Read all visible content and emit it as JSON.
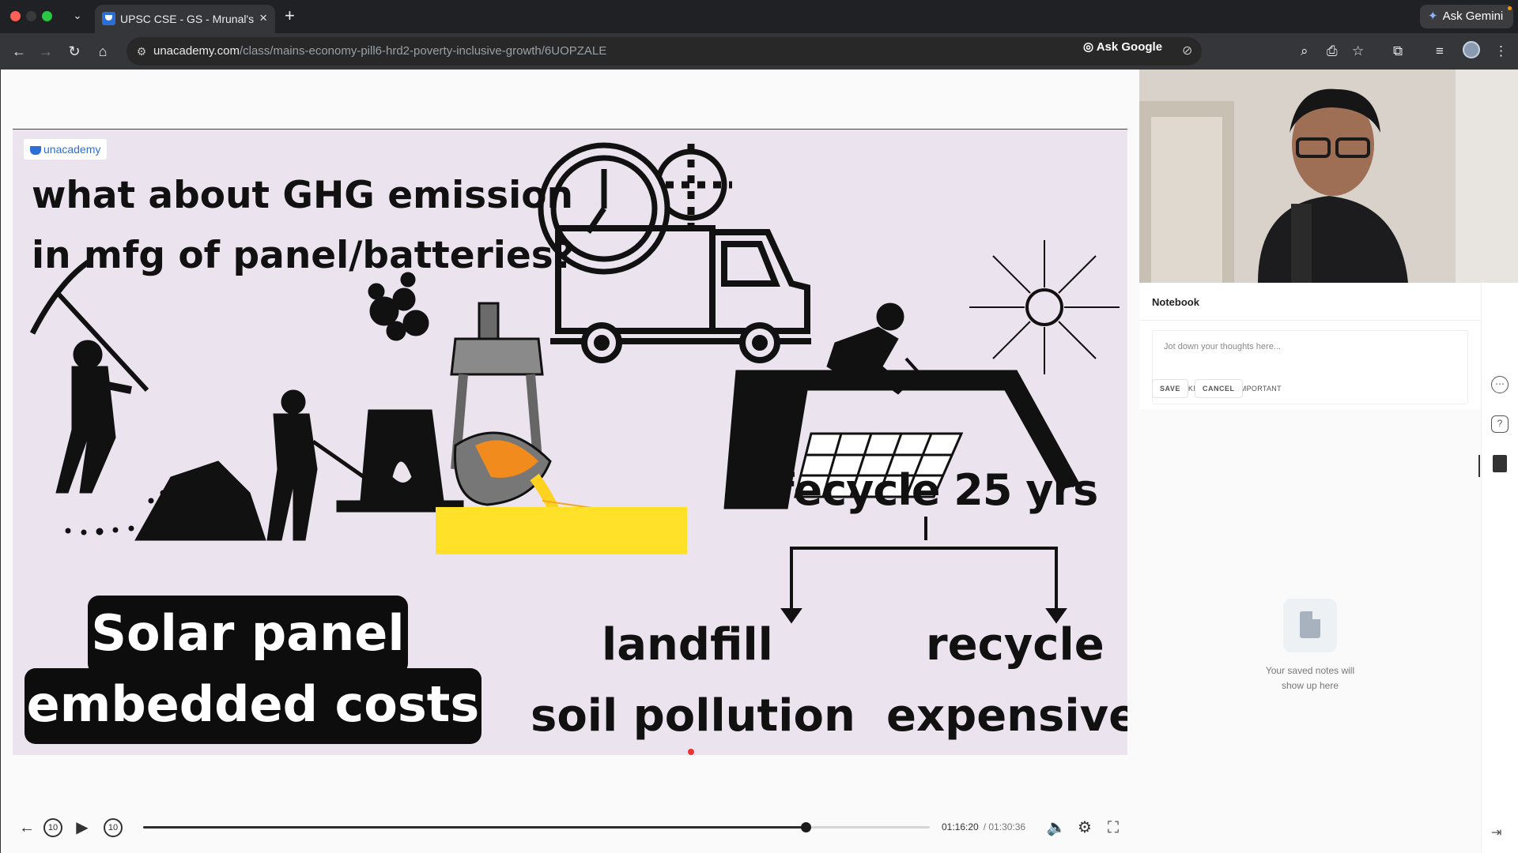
{
  "browser": {
    "tab_title": "UPSC CSE - GS - Mrunal's Ec",
    "url_host": "unacademy.com",
    "url_path": "/class/mains-economy-pill6-hrd2-poverty-inclusive-growth/6UOPZALE",
    "ask_google": "Ask Google",
    "ask_gemini": "Ask Gemini"
  },
  "slide": {
    "logo": "unacademy",
    "question_line1": "what about GHG emission",
    "question_line2": "in mfg of panel/batteries?",
    "lifecycle": "lifecycle 25 yrs",
    "landfill": "landfill",
    "recycle": "recycle",
    "soil_pollution": "soil pollution",
    "expensive": "expensive",
    "box_line1": "Solar panel",
    "box_line2": "embedded costs",
    "accent_yellow": "#ffe12a"
  },
  "player": {
    "rewind_label": "10",
    "forward_label": "10",
    "current_time": "01:16:20",
    "duration": "/ 01:30:36",
    "progress_fraction": 0.8425
  },
  "notebook": {
    "title": "Notebook",
    "placeholder": "Jot down your thoughts here...",
    "bookmark_label": "BOOKMARK",
    "important_label": "IMPORTANT",
    "save_label": "SAVE",
    "cancel_label": "CANCEL",
    "empty_line1": "Your saved notes will",
    "empty_line2": "show up here"
  },
  "icons": [
    "back-icon",
    "forward-icon",
    "reload-icon",
    "home-icon",
    "site-info-icon",
    "eye-off-icon",
    "lens-icon",
    "zoom-icon",
    "install-icon",
    "star-icon",
    "extensions-icon",
    "reading-list-icon",
    "profile-avatar",
    "more-icon",
    "play-icon",
    "volume-icon",
    "settings-icon",
    "fullscreen-icon",
    "chat-icon",
    "doubt-icon",
    "notebook-icon",
    "exit-icon"
  ]
}
